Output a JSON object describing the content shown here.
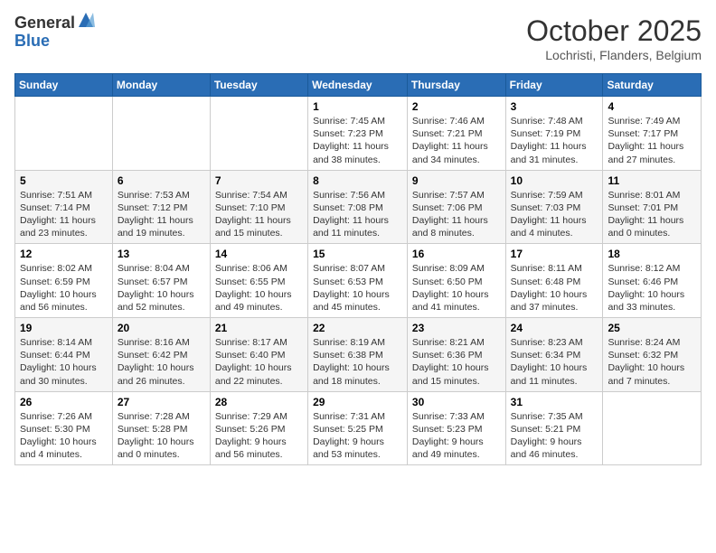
{
  "header": {
    "logo_general": "General",
    "logo_blue": "Blue",
    "month_title": "October 2025",
    "location": "Lochristi, Flanders, Belgium"
  },
  "weekdays": [
    "Sunday",
    "Monday",
    "Tuesday",
    "Wednesday",
    "Thursday",
    "Friday",
    "Saturday"
  ],
  "weeks": [
    [
      {
        "day": "",
        "info": ""
      },
      {
        "day": "",
        "info": ""
      },
      {
        "day": "",
        "info": ""
      },
      {
        "day": "1",
        "info": "Sunrise: 7:45 AM\nSunset: 7:23 PM\nDaylight: 11 hours\nand 38 minutes."
      },
      {
        "day": "2",
        "info": "Sunrise: 7:46 AM\nSunset: 7:21 PM\nDaylight: 11 hours\nand 34 minutes."
      },
      {
        "day": "3",
        "info": "Sunrise: 7:48 AM\nSunset: 7:19 PM\nDaylight: 11 hours\nand 31 minutes."
      },
      {
        "day": "4",
        "info": "Sunrise: 7:49 AM\nSunset: 7:17 PM\nDaylight: 11 hours\nand 27 minutes."
      }
    ],
    [
      {
        "day": "5",
        "info": "Sunrise: 7:51 AM\nSunset: 7:14 PM\nDaylight: 11 hours\nand 23 minutes."
      },
      {
        "day": "6",
        "info": "Sunrise: 7:53 AM\nSunset: 7:12 PM\nDaylight: 11 hours\nand 19 minutes."
      },
      {
        "day": "7",
        "info": "Sunrise: 7:54 AM\nSunset: 7:10 PM\nDaylight: 11 hours\nand 15 minutes."
      },
      {
        "day": "8",
        "info": "Sunrise: 7:56 AM\nSunset: 7:08 PM\nDaylight: 11 hours\nand 11 minutes."
      },
      {
        "day": "9",
        "info": "Sunrise: 7:57 AM\nSunset: 7:06 PM\nDaylight: 11 hours\nand 8 minutes."
      },
      {
        "day": "10",
        "info": "Sunrise: 7:59 AM\nSunset: 7:03 PM\nDaylight: 11 hours\nand 4 minutes."
      },
      {
        "day": "11",
        "info": "Sunrise: 8:01 AM\nSunset: 7:01 PM\nDaylight: 11 hours\nand 0 minutes."
      }
    ],
    [
      {
        "day": "12",
        "info": "Sunrise: 8:02 AM\nSunset: 6:59 PM\nDaylight: 10 hours\nand 56 minutes."
      },
      {
        "day": "13",
        "info": "Sunrise: 8:04 AM\nSunset: 6:57 PM\nDaylight: 10 hours\nand 52 minutes."
      },
      {
        "day": "14",
        "info": "Sunrise: 8:06 AM\nSunset: 6:55 PM\nDaylight: 10 hours\nand 49 minutes."
      },
      {
        "day": "15",
        "info": "Sunrise: 8:07 AM\nSunset: 6:53 PM\nDaylight: 10 hours\nand 45 minutes."
      },
      {
        "day": "16",
        "info": "Sunrise: 8:09 AM\nSunset: 6:50 PM\nDaylight: 10 hours\nand 41 minutes."
      },
      {
        "day": "17",
        "info": "Sunrise: 8:11 AM\nSunset: 6:48 PM\nDaylight: 10 hours\nand 37 minutes."
      },
      {
        "day": "18",
        "info": "Sunrise: 8:12 AM\nSunset: 6:46 PM\nDaylight: 10 hours\nand 33 minutes."
      }
    ],
    [
      {
        "day": "19",
        "info": "Sunrise: 8:14 AM\nSunset: 6:44 PM\nDaylight: 10 hours\nand 30 minutes."
      },
      {
        "day": "20",
        "info": "Sunrise: 8:16 AM\nSunset: 6:42 PM\nDaylight: 10 hours\nand 26 minutes."
      },
      {
        "day": "21",
        "info": "Sunrise: 8:17 AM\nSunset: 6:40 PM\nDaylight: 10 hours\nand 22 minutes."
      },
      {
        "day": "22",
        "info": "Sunrise: 8:19 AM\nSunset: 6:38 PM\nDaylight: 10 hours\nand 18 minutes."
      },
      {
        "day": "23",
        "info": "Sunrise: 8:21 AM\nSunset: 6:36 PM\nDaylight: 10 hours\nand 15 minutes."
      },
      {
        "day": "24",
        "info": "Sunrise: 8:23 AM\nSunset: 6:34 PM\nDaylight: 10 hours\nand 11 minutes."
      },
      {
        "day": "25",
        "info": "Sunrise: 8:24 AM\nSunset: 6:32 PM\nDaylight: 10 hours\nand 7 minutes."
      }
    ],
    [
      {
        "day": "26",
        "info": "Sunrise: 7:26 AM\nSunset: 5:30 PM\nDaylight: 10 hours\nand 4 minutes."
      },
      {
        "day": "27",
        "info": "Sunrise: 7:28 AM\nSunset: 5:28 PM\nDaylight: 10 hours\nand 0 minutes."
      },
      {
        "day": "28",
        "info": "Sunrise: 7:29 AM\nSunset: 5:26 PM\nDaylight: 9 hours\nand 56 minutes."
      },
      {
        "day": "29",
        "info": "Sunrise: 7:31 AM\nSunset: 5:25 PM\nDaylight: 9 hours\nand 53 minutes."
      },
      {
        "day": "30",
        "info": "Sunrise: 7:33 AM\nSunset: 5:23 PM\nDaylight: 9 hours\nand 49 minutes."
      },
      {
        "day": "31",
        "info": "Sunrise: 7:35 AM\nSunset: 5:21 PM\nDaylight: 9 hours\nand 46 minutes."
      },
      {
        "day": "",
        "info": ""
      }
    ]
  ]
}
